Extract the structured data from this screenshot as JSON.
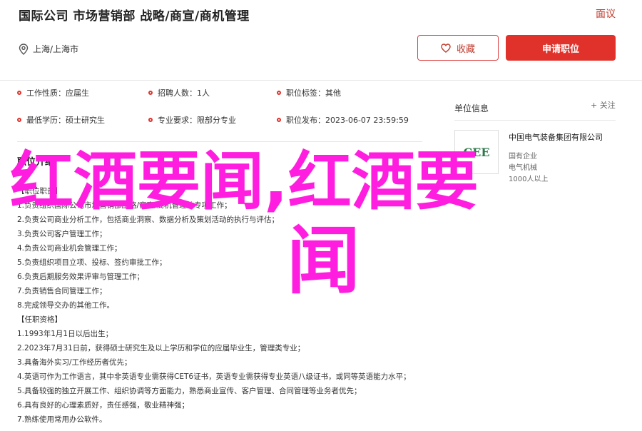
{
  "header": {
    "title": "国际公司 市场营销部 战略/商宣/商机管理",
    "report_label": "面议",
    "location": "上海/上海市",
    "favorite_label": "收藏",
    "apply_label": "申请职位"
  },
  "meta": {
    "row1": [
      "工作性质：应届生",
      "招聘人数：1人",
      "职位标签：其他"
    ],
    "row2": [
      "最低学历：硕士研究生",
      "专业要求：限部分专业",
      "职位发布：2023-06-07 23:59:59"
    ]
  },
  "section_title": "职位介绍",
  "description": [
    "【职位职责】",
    "1.负责组织国际公司市场营销部战略/商宣/商机管理的专项工作；",
    "2.负责公司商业分析工作，包括商业洞察、数据分析及策划活动的执行与评估；",
    "3.负责公司客户管理工作；",
    "4.负责公司商业机会管理工作；",
    "5.负责组织项目立项、投标、签约审批工作；",
    "6.负责后期服务效果评审与管理工作；",
    "7.负责销售合同管理工作；",
    "8.完成领导交办的其他工作。",
    "【任职资格】",
    "1.1993年1月1日以后出生；",
    "2.2023年7月31日前，获得硕士研究生及以上学历和学位的应届毕业生，管理类专业；",
    "3.具备海外实习/工作经历者优先；",
    "4.英语可作为工作语言，其中非英语专业需获得CET6证书，英语专业需获得专业英语八级证书，或同等英语能力水平；",
    "5.具备较强的独立开展工作、组织协调等方面能力，熟悉商业宣传、客户管理、合同管理等业务者优先；",
    "6.具有良好的心理素质好，责任感强，敬业精神强；",
    "7.熟练使用常用办公软件。"
  ],
  "sidebar": {
    "title": "单位信息",
    "follow_label": "+ 关注",
    "logo_text": "CEE",
    "company": "中国电气装备集团有限公司",
    "nature": "国有企业",
    "industry": "电气机械",
    "size": "1000人以上"
  },
  "overlay": {
    "line1": "红酒要闻,红酒要",
    "line2": "闻"
  }
}
